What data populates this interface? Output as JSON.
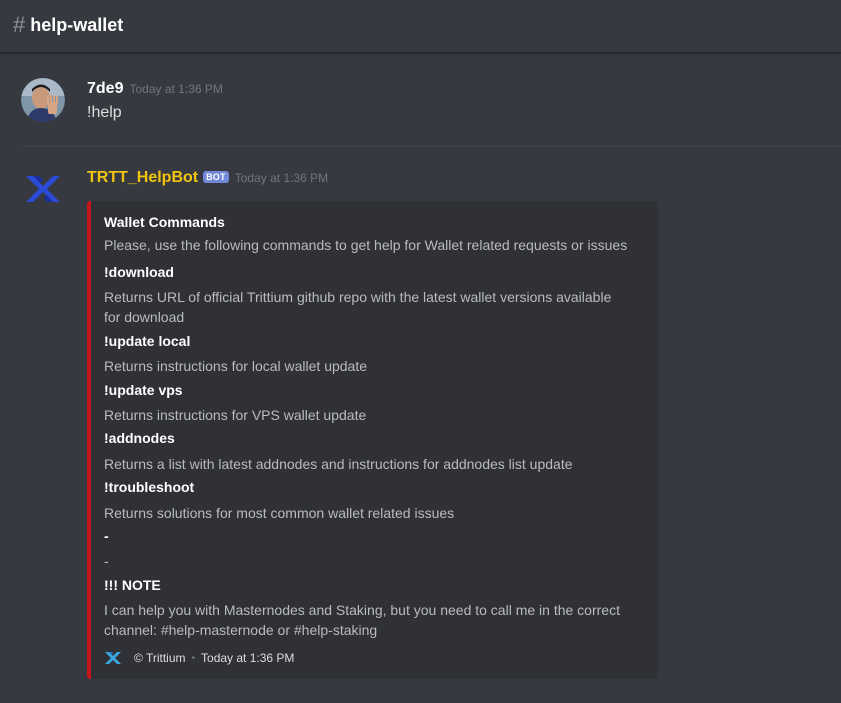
{
  "channel": {
    "hash": "#",
    "name": "help-wallet"
  },
  "messages": [
    {
      "username": "7de9",
      "timestamp": "Today at 1:36 PM",
      "content": "!help"
    },
    {
      "username": "TRTT_HelpBot",
      "badge": "BOT",
      "timestamp": "Today at 1:36 PM",
      "embed": {
        "color": "#c4151c",
        "title": "Wallet Commands",
        "description": "Please, use the following commands to get help for Wallet related requests or issues",
        "fields": [
          {
            "name": "!download",
            "value": "Returns URL of official Trittium github repo with the latest wallet versions available",
            "value2": "for download"
          },
          {
            "name": "!update local",
            "value": "Returns instructions for local wallet update"
          },
          {
            "name": "!update vps",
            "value": "Returns instructions for VPS wallet update"
          },
          {
            "name": "!addnodes",
            "value": "Returns a list with latest addnodes and instructions for addnodes list update"
          },
          {
            "name": "!troubleshoot",
            "value": "Returns solutions for most common wallet related issues"
          },
          {
            "name": "-",
            "value": "-"
          },
          {
            "name": "!!! NOTE",
            "value": "I can help you with Masternodes and Staking, but you need to call me in the correct",
            "value2": "channel: #help-masternode or #help-staking"
          }
        ],
        "footer": {
          "text": "© Trittium",
          "separator": "•",
          "timestamp": "Today at 1:36 PM"
        }
      }
    }
  ],
  "colors": {
    "bot_name": "#f1c40f",
    "embed_border": "#c4151c",
    "bot_badge": "#7289da"
  },
  "icons": [
    "hash-icon",
    "user-avatar",
    "trittium-logo-icon"
  ]
}
